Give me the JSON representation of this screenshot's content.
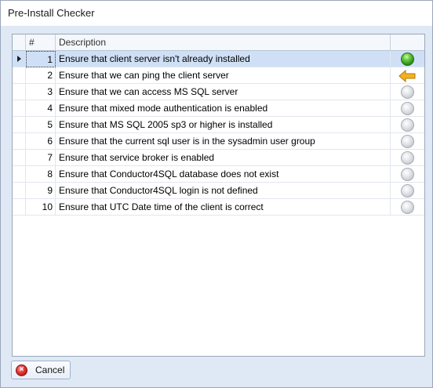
{
  "window": {
    "title": "Pre-Install Checker"
  },
  "grid": {
    "columns": [
      {
        "key": "num",
        "label": "#"
      },
      {
        "key": "description",
        "label": "Description"
      },
      {
        "key": "status",
        "label": ""
      }
    ],
    "selected_row": 0,
    "rows": [
      {
        "num": "1",
        "description": "Ensure that client server isn't already installed",
        "status": "passed",
        "status_icon": "green-check-icon"
      },
      {
        "num": "2",
        "description": "Ensure that we can ping the client server",
        "status": "in-progress",
        "status_icon": "arrow-left-icon"
      },
      {
        "num": "3",
        "description": "Ensure that we can access MS SQL server",
        "status": "pending",
        "status_icon": "grey-circle-icon"
      },
      {
        "num": "4",
        "description": "Ensure that mixed mode authentication is enabled",
        "status": "pending",
        "status_icon": "grey-circle-icon"
      },
      {
        "num": "5",
        "description": "Ensure that MS SQL 2005 sp3 or higher is installed",
        "status": "pending",
        "status_icon": "grey-circle-icon"
      },
      {
        "num": "6",
        "description": "Ensure that the current sql user is in the sysadmin user group",
        "status": "pending",
        "status_icon": "grey-circle-icon"
      },
      {
        "num": "7",
        "description": "Ensure that service broker is enabled",
        "status": "pending",
        "status_icon": "grey-circle-icon"
      },
      {
        "num": "8",
        "description": "Ensure that Conductor4SQL database does not exist",
        "status": "pending",
        "status_icon": "grey-circle-icon"
      },
      {
        "num": "9",
        "description": "Ensure that Conductor4SQL login is not defined",
        "status": "pending",
        "status_icon": "grey-circle-icon"
      },
      {
        "num": "10",
        "description": "Ensure that UTC Date time of the client is correct",
        "status": "pending",
        "status_icon": "grey-circle-icon"
      }
    ]
  },
  "footer": {
    "cancel_label": "Cancel",
    "cancel_icon": "cancel-icon"
  },
  "colors": {
    "passed": "#2b8f1b",
    "in_progress": "#f3b21a",
    "pending": "#c8ccd2",
    "selection": "#cfe0f6"
  }
}
